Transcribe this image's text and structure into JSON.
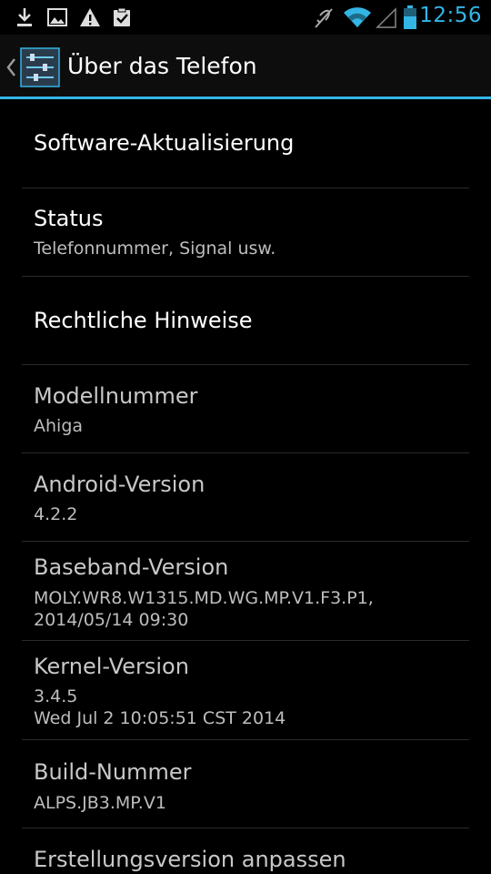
{
  "status_bar": {
    "time": "12:56",
    "icons": [
      "download-icon",
      "image-icon",
      "warning-icon",
      "clipboard-check-icon",
      "mute-icon",
      "wifi-icon",
      "signal-icon",
      "battery-icon"
    ]
  },
  "action_bar": {
    "title": "Über das Telefon",
    "app_icon": "settings-sliders-icon"
  },
  "items": [
    {
      "title": "Software-Aktualisierung",
      "summary": ""
    },
    {
      "title": "Status",
      "summary": "Telefonnummer, Signal usw."
    },
    {
      "title": "Rechtliche Hinweise",
      "summary": ""
    },
    {
      "title": "Modellnummer",
      "summary": "Ahiga"
    },
    {
      "title": "Android-Version",
      "summary": "4.2.2"
    },
    {
      "title": "Baseband-Version",
      "summary": "MOLY.WR8.W1315.MD.WG.MP.V1.F3.P1,\n2014/05/14 09:30"
    },
    {
      "title": "Kernel-Version",
      "summary": "3.4.5\nWed Jul 2 10:05:51 CST 2014"
    },
    {
      "title": "Build-Nummer",
      "summary": "ALPS.JB3.MP.V1"
    },
    {
      "title": "Erstellungsversion anpassen",
      "summary": ""
    }
  ],
  "colors": {
    "accent": "#33b5e5",
    "background": "#000000",
    "summary_text": "#bdbdbd"
  }
}
